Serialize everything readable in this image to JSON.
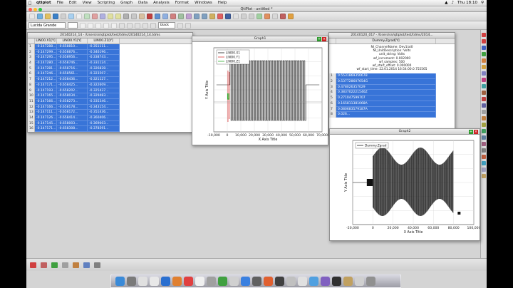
{
  "menubar": {
    "app": "qtiplot",
    "items": [
      "File",
      "Edit",
      "View",
      "Scripting",
      "Graph",
      "Data",
      "Analysis",
      "Format",
      "Windows",
      "Help"
    ],
    "clock": "Thu 18:10"
  },
  "window_title": "QtiPlot - untitled *",
  "toolbar": {
    "font_name": "Lucida Grande",
    "color_label": "black"
  },
  "table1": {
    "title": "20140214_14 - /Users/sn/qtiplot/test/tdms/20140214_14.tdms",
    "columns": [
      "LINO0.X1[Y]",
      "LINO0.Y1[Y]",
      "LINO0.Z1[Y]"
    ],
    "rows": [
      {
        "n": "1",
        "c": [
          "-0.147288...",
          "-0.658810...",
          "-0.351111..."
        ]
      },
      {
        "n": "2",
        "c": [
          "-0.147299...",
          "-0.658876...",
          "-0.346196..."
        ]
      },
      {
        "n": "3",
        "c": [
          "-0.147295...",
          "-0.658956...",
          "-0.338743..."
        ]
      },
      {
        "n": "4",
        "c": [
          "-0.147280...",
          "-0.658746...",
          "-0.331124..."
        ]
      },
      {
        "n": "5",
        "c": [
          "-0.147281...",
          "-0.658716...",
          "-0.326828..."
        ]
      },
      {
        "n": "6",
        "c": [
          "-0.147246...",
          "-0.658561...",
          "-0.323507..."
        ]
      },
      {
        "n": "7",
        "c": [
          "-0.147212...",
          "-0.658436...",
          "-0.321127..."
        ]
      },
      {
        "n": "8",
        "c": [
          "-0.147171...",
          "-0.658425...",
          "-0.322609..."
        ]
      },
      {
        "n": "9",
        "c": [
          "-0.147193...",
          "-0.658202...",
          "-0.325437..."
        ]
      },
      {
        "n": "10",
        "c": [
          "-0.147165...",
          "-0.658034...",
          "-0.329483..."
        ]
      },
      {
        "n": "11",
        "c": [
          "-0.147166...",
          "-0.658273...",
          "-0.335346..."
        ]
      },
      {
        "n": "12",
        "c": [
          "-0.147166...",
          "-0.658178...",
          "-0.343154..."
        ]
      },
      {
        "n": "13",
        "c": [
          "-0.147111...",
          "-0.658172...",
          "-0.351436..."
        ]
      },
      {
        "n": "14",
        "c": [
          "-0.147126...",
          "-0.658414...",
          "-0.360406..."
        ]
      },
      {
        "n": "15",
        "c": [
          "-0.147145...",
          "-0.658003...",
          "-0.369003..."
        ]
      },
      {
        "n": "16",
        "c": [
          "-0.147171...",
          "-0.658308...",
          "-0.378591..."
        ]
      }
    ]
  },
  "table2": {
    "title": "20140120_017 - /Users/sn/qtiplot/test/tdms/2014...",
    "column": "Dummy.Zgrad[Y]",
    "props": [
      "NI_ChannelName: Dev1/ai0",
      "NI_UnitDescription: Volts",
      "unit_string: Volts",
      "wf_increment: 0.002000",
      "wf_samples: 500",
      "wf_start_offset: 0.000000",
      "wf_start_time: 22.01.2014 16:54:00.0.755565"
    ],
    "rows": [
      {
        "n": "1",
        "v": "0.553186935067B"
      },
      {
        "n": "2",
        "v": "0.537728607654G"
      },
      {
        "n": "3",
        "v": "0.478026357029"
      },
      {
        "n": "4",
        "v": "0.383702221546Z"
      },
      {
        "n": "5",
        "v": "0.271047599707"
      },
      {
        "n": "6",
        "v": "0.165811381068A"
      },
      {
        "n": "7",
        "v": "0.080683579187A"
      },
      {
        "n": "8",
        "v": "0.026..."
      }
    ]
  },
  "graph1": {
    "title": "Graph1"
  },
  "graph2": {
    "title": "Graph2"
  },
  "chart_data": [
    {
      "type": "line",
      "title": "",
      "xlabel": "X Axis Title",
      "ylabel": "Y Axis Title",
      "xlim": [
        -10000,
        70000
      ],
      "xticks": [
        "-10,000",
        "0",
        "10,000",
        "20,000",
        "30,000",
        "40,000",
        "50,000",
        "60,000",
        "70,000"
      ],
      "series": [
        {
          "name": "LINO0.X1",
          "color": "#1a1a1a"
        },
        {
          "name": "LINO0.Y1",
          "color": "#d93a3a"
        },
        {
          "name": "LINO0.Z1",
          "color": "#2fae2f"
        }
      ],
      "legend": "top-left"
    },
    {
      "type": "line",
      "title": "",
      "xlabel": "X Axis Title",
      "ylabel": "Y Axis Title",
      "xlim": [
        -20000,
        100000
      ],
      "xticks": [
        "-20,000",
        "0",
        "20,000",
        "40,000",
        "60,000",
        "80,000",
        "100,000"
      ],
      "series": [
        {
          "name": "Dummy.Zgrad",
          "color": "#1a1a1a"
        }
      ],
      "legend": "top-left"
    }
  ]
}
